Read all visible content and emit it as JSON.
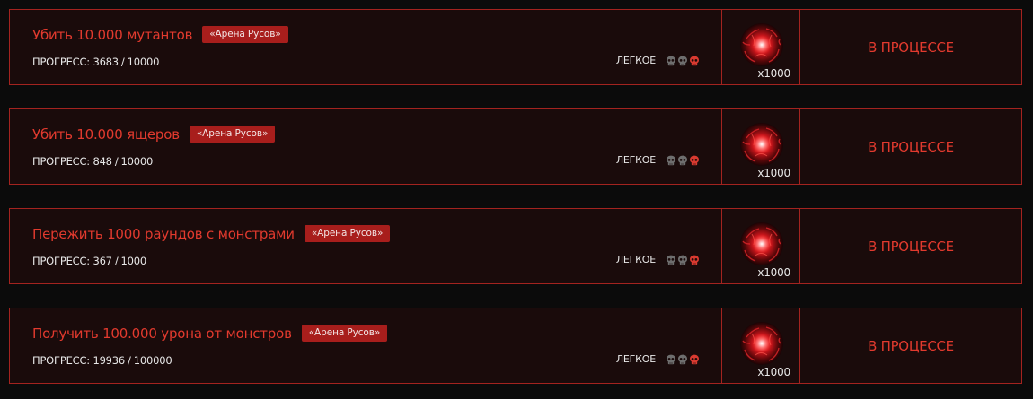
{
  "quests": [
    {
      "title": "Убить 10.000 мутантов",
      "tag": "«Арена Русов»",
      "progress_label": "ПРОГРЕСС:",
      "progress_current": "3683",
      "progress_total": "10000",
      "difficulty_label": "ЛЕГКОЕ",
      "difficulty_level": 1,
      "difficulty_max": 3,
      "reward_icon": "red-orb-icon",
      "reward_count": "x1000",
      "status": "В ПРОЦЕССЕ"
    },
    {
      "title": "Убить 10.000 ящеров",
      "tag": "«Арена Русов»",
      "progress_label": "ПРОГРЕСС:",
      "progress_current": "848",
      "progress_total": "10000",
      "difficulty_label": "ЛЕГКОЕ",
      "difficulty_level": 1,
      "difficulty_max": 3,
      "reward_icon": "red-orb-icon",
      "reward_count": "x1000",
      "status": "В ПРОЦЕССЕ"
    },
    {
      "title": "Пережить 1000 раундов с монстрами",
      "tag": "«Арена Русов»",
      "progress_label": "ПРОГРЕСС:",
      "progress_current": "367",
      "progress_total": "1000",
      "difficulty_label": "ЛЕГКОЕ",
      "difficulty_level": 1,
      "difficulty_max": 3,
      "reward_icon": "red-orb-icon",
      "reward_count": "x1000",
      "status": "В ПРОЦЕССЕ"
    },
    {
      "title": "Получить 100.000 урона от монстров",
      "tag": "«Арена Русов»",
      "progress_label": "ПРОГРЕСС:",
      "progress_current": "19936",
      "progress_total": "100000",
      "difficulty_label": "ЛЕГКОЕ",
      "difficulty_level": 1,
      "difficulty_max": 3,
      "reward_icon": "red-orb-icon",
      "reward_count": "x1000",
      "status": "В ПРОЦЕССЕ"
    }
  ],
  "colors": {
    "accent": "#e23a2e",
    "border": "#a3231f",
    "tag_bg": "#a81e1c",
    "card_bg": "#1a0b0b",
    "page_bg": "#0b0b0b",
    "skull_active": "#d93a30",
    "skull_inactive": "#6e6e6e"
  }
}
